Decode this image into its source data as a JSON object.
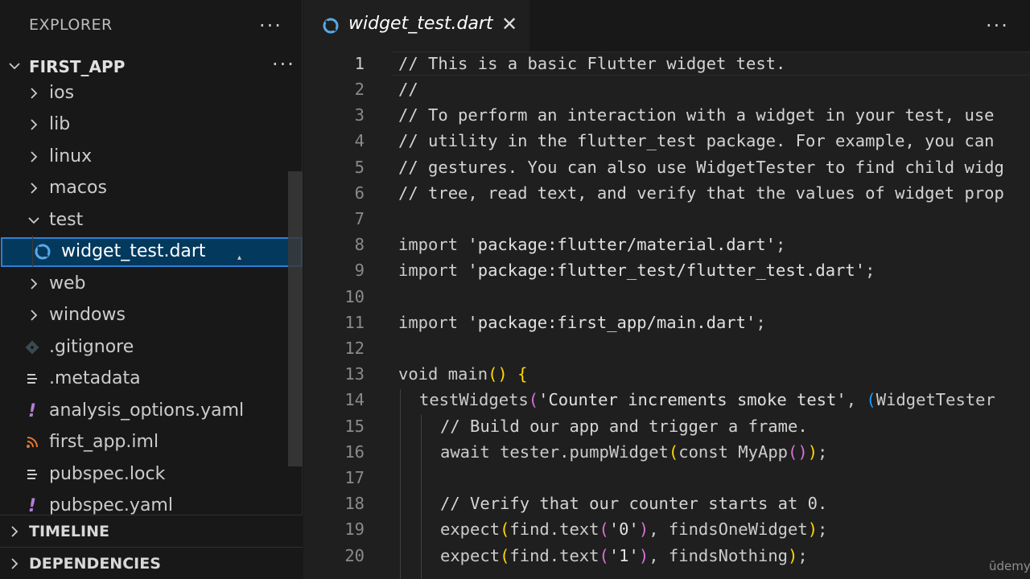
{
  "sidebar": {
    "title": "EXPLORER",
    "more_icon": "ellipsis-icon",
    "folder": "FIRST_APP",
    "items": [
      {
        "label": "ios",
        "icon": "chevron-right-icon"
      },
      {
        "label": "lib",
        "icon": "chevron-right-icon"
      },
      {
        "label": "linux",
        "icon": "chevron-right-icon"
      },
      {
        "label": "macos",
        "icon": "chevron-right-icon"
      },
      {
        "label": "test",
        "icon": "chevron-down-icon"
      },
      {
        "label": "widget_test.dart",
        "icon": "dart-icon",
        "selected": true
      },
      {
        "label": "web",
        "icon": "chevron-right-icon"
      },
      {
        "label": "windows",
        "icon": "chevron-right-icon"
      },
      {
        "label": ".gitignore",
        "icon": "git-icon"
      },
      {
        "label": ".metadata",
        "icon": "lines-icon"
      },
      {
        "label": "analysis_options.yaml",
        "icon": "exclamation-icon"
      },
      {
        "label": "first_app.iml",
        "icon": "rss-icon"
      },
      {
        "label": "pubspec.lock",
        "icon": "lines-icon"
      },
      {
        "label": "pubspec.yaml",
        "icon": "exclamation-icon"
      }
    ],
    "panels": [
      "TIMELINE",
      "DEPENDENCIES"
    ]
  },
  "editor": {
    "tab": {
      "label": "widget_test.dart",
      "icon": "dart-icon"
    },
    "line_numbers": [
      "1",
      "2",
      "3",
      "4",
      "5",
      "6",
      "7",
      "8",
      "9",
      "10",
      "11",
      "12",
      "13",
      "14",
      "15",
      "16",
      "17",
      "18",
      "19",
      "20"
    ],
    "current_line": "1"
  },
  "code": {
    "l1": "// This is a basic Flutter widget test.",
    "l2": "//",
    "l3": "// To perform an interaction with a widget in your test, use",
    "l4": "// utility in the flutter_test package. For example, you can",
    "l5": "// gestures. You can also use WidgetTester to find child widg",
    "l6": "// tree, read text, and verify that the values of widget prop",
    "l8_kw": "import",
    "l8_str": "'package:flutter/material.dart'",
    "l9_kw": "import",
    "l9_str": "'package:flutter_test/flutter_test.dart'",
    "l11_kw": "import",
    "l11_str": "'package:first_app/main.dart'",
    "l13_kw": "void",
    "l13_fn": "main",
    "l14_fn": "testWidgets",
    "l14_str": "'Counter increments smoke test'",
    "l14_ty": "WidgetTester",
    "l15": "// Build our app and trigger a frame.",
    "l16_kw": "await",
    "l16_obj": "tester",
    "l16_fn": "pumpWidget",
    "l16_kw2": "const",
    "l16_ty": "MyApp",
    "l18": "// Verify that our counter starts at 0.",
    "l19_fn": "expect",
    "l19_obj": "find",
    "l19_fn2": "text",
    "l19_str": "'0'",
    "l19_c": "findsOneWidget",
    "l20_fn": "expect",
    "l20_obj": "find",
    "l20_fn2": "text",
    "l20_str": "'1'",
    "l20_c": "findsNothing"
  },
  "watermark": "ūdemy"
}
